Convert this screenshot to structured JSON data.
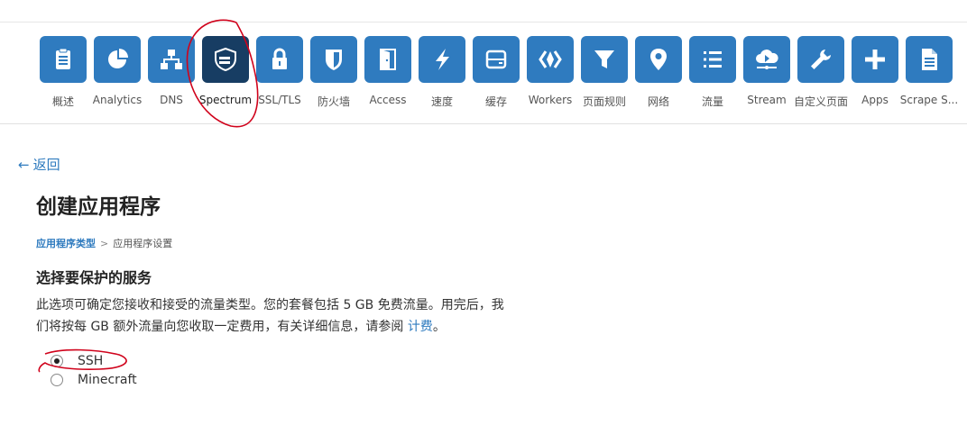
{
  "nav": {
    "items": [
      {
        "label": "概述",
        "icon": "clipboard-icon",
        "active": false
      },
      {
        "label": "Analytics",
        "icon": "pie-chart-icon",
        "active": false
      },
      {
        "label": "DNS",
        "icon": "network-icon",
        "active": false
      },
      {
        "label": "Spectrum",
        "icon": "spectrum-shield-icon",
        "active": true
      },
      {
        "label": "SSL/TLS",
        "icon": "lock-icon",
        "active": false
      },
      {
        "label": "防火墙",
        "icon": "shield-icon",
        "active": false
      },
      {
        "label": "Access",
        "icon": "door-icon",
        "active": false
      },
      {
        "label": "速度",
        "icon": "lightning-icon",
        "active": false
      },
      {
        "label": "缓存",
        "icon": "storage-drive-icon",
        "active": false
      },
      {
        "label": "Workers",
        "icon": "workers-icon",
        "active": false
      },
      {
        "label": "页面规则",
        "icon": "filter-icon",
        "active": false
      },
      {
        "label": "网络",
        "icon": "location-pin-icon",
        "active": false
      },
      {
        "label": "流量",
        "icon": "list-icon",
        "active": false
      },
      {
        "label": "Stream",
        "icon": "cloud-play-icon",
        "active": false
      },
      {
        "label": "自定义页面",
        "icon": "wrench-icon",
        "active": false
      },
      {
        "label": "Apps",
        "icon": "plus-icon",
        "active": false
      },
      {
        "label": "Scrape S...",
        "icon": "document-icon",
        "active": false
      }
    ]
  },
  "back": {
    "label": "返回"
  },
  "page": {
    "title": "创建应用程序"
  },
  "breadcrumb": {
    "step1": "应用程序类型",
    "separator": ">",
    "step2": "应用程序设置"
  },
  "section": {
    "heading": "选择要保护的服务",
    "description_line1": "此选项可确定您接收和接受的流量类型。您的套餐包括 5 GB 免费流量。用完后，我",
    "description_line2": "们将按每 GB 额外流量向您收取一定费用，有关详细信息，请参阅 ",
    "billing_link": "计费",
    "period": "。"
  },
  "options": {
    "ssh": {
      "label": "SSH",
      "selected": true
    },
    "minecraft": {
      "label": "Minecraft",
      "selected": false
    }
  },
  "colors": {
    "accent": "#2f7bbf",
    "active_tile": "#173d63",
    "annotation": "#d0021b"
  }
}
